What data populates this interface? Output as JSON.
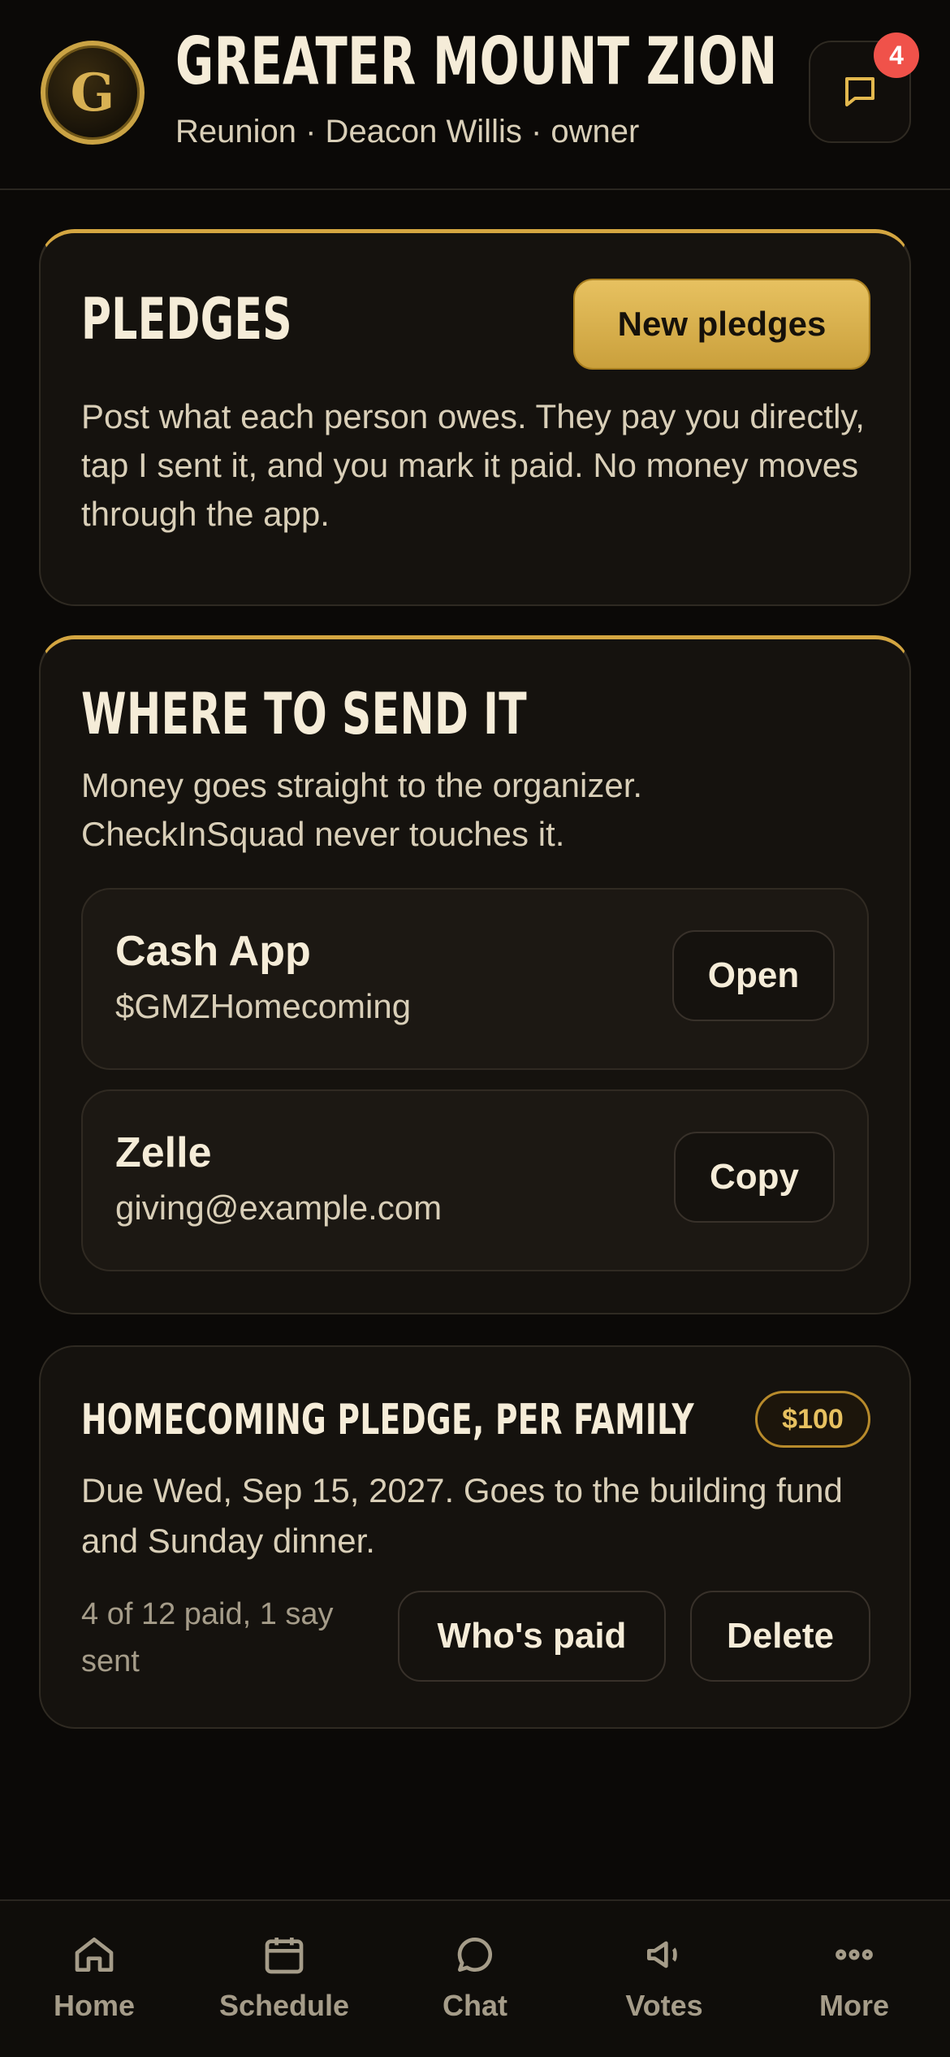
{
  "header": {
    "logo_letter": "G",
    "title": "GREATER MOUNT ZION",
    "subtitle": "Reunion · Deacon Willis · owner",
    "notification_count": "4"
  },
  "pledges_card": {
    "title": "PLEDGES",
    "new_button": "New pledges",
    "description": "Post what each person owes. They pay you directly, tap I sent it, and you mark it paid. No money moves through the app."
  },
  "send_card": {
    "title": "WHERE TO SEND IT",
    "description": "Money goes straight to the organizer. CheckInSquad never touches it.",
    "methods": [
      {
        "name": "Cash App",
        "handle": "$GMZHomecoming",
        "action": "Open"
      },
      {
        "name": "Zelle",
        "handle": "giving@example.com",
        "action": "Copy"
      }
    ]
  },
  "pledge_item": {
    "title": "HOMECOMING PLEDGE, PER FAMILY",
    "amount": "$100",
    "description": "Due Wed, Sep 15, 2027. Goes to the building fund and Sunday dinner.",
    "status": "4 of 12 paid, 1 say sent",
    "whos_paid_button": "Who's paid",
    "delete_button": "Delete"
  },
  "nav": {
    "items": [
      {
        "label": "Home",
        "icon": "home-icon"
      },
      {
        "label": "Schedule",
        "icon": "calendar-icon"
      },
      {
        "label": "Chat",
        "icon": "chat-icon"
      },
      {
        "label": "Votes",
        "icon": "megaphone-icon"
      },
      {
        "label": "More",
        "icon": "more-icon"
      }
    ]
  },
  "colors": {
    "background": "#0b0907",
    "card": "#15120e",
    "accent_gold": "#d4a641",
    "badge_red": "#f0524a"
  }
}
